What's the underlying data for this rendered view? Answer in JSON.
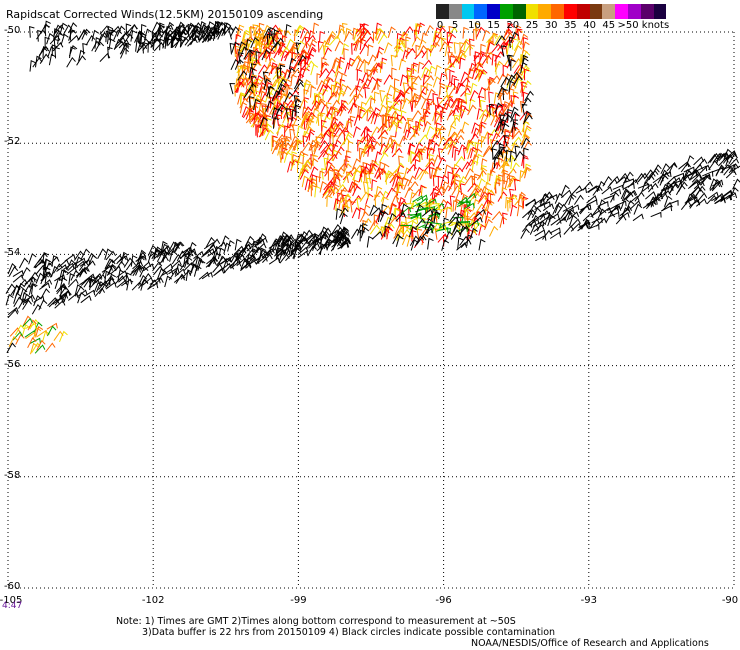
{
  "title": "Rapidscat Corrected Winds(12.5KM) 20150109 ascending",
  "legend": {
    "colors": [
      "#222222",
      "#888888",
      "#00c8f0",
      "#0066ff",
      "#0000c8",
      "#00a000",
      "#006400",
      "#f0e000",
      "#ffaa00",
      "#ff6600",
      "#ff0000",
      "#c00000",
      "#7a3a10",
      "#c8a080",
      "#ff00ff",
      "#a000c8",
      "#5a006a",
      "#1a0040"
    ],
    "labels": [
      {
        "text": "0",
        "frac": 0.0
      },
      {
        "text": "5",
        "frac": 0.083
      },
      {
        "text": "10",
        "frac": 0.167
      },
      {
        "text": "15",
        "frac": 0.25
      },
      {
        "text": "20",
        "frac": 0.333
      },
      {
        "text": "25",
        "frac": 0.417
      },
      {
        "text": "30",
        "frac": 0.5
      },
      {
        "text": "35",
        "frac": 0.583
      },
      {
        "text": "40",
        "frac": 0.667
      },
      {
        "text": "45",
        "frac": 0.75
      },
      {
        "text": ">50 knots",
        "frac": 0.9
      }
    ]
  },
  "axes": {
    "lat_labels": [
      {
        "text": "-50",
        "value": -50
      },
      {
        "text": "-52",
        "value": -52
      },
      {
        "text": "-54",
        "value": -54
      },
      {
        "text": "-56",
        "value": -56
      },
      {
        "text": "-58",
        "value": -58
      },
      {
        "text": "-60",
        "value": -60
      }
    ],
    "lon_labels": [
      {
        "text": "-105",
        "value": -105
      },
      {
        "text": "-102",
        "value": -102
      },
      {
        "text": "-99",
        "value": -99
      },
      {
        "text": "-96",
        "value": -96
      },
      {
        "text": "-93",
        "value": -93
      },
      {
        "text": "-90",
        "value": -90
      }
    ],
    "lat_range": [
      -60,
      -50
    ],
    "lon_range": [
      -105,
      -90
    ]
  },
  "time_label": "4:47",
  "notes": {
    "line1": "Note: 1) Times are GMT 2)Times along bottom correspond to measurement at ~50S",
    "line2": "3)Data buffer is 22 hrs from 20150109 4) Black circles indicate possible contamination"
  },
  "credit": "NOAA/NESDIS/Office of Research and Applications",
  "wind_colors": {
    "rain_flag": "#000000",
    "c15": "#00a000",
    "c20": "#f0e000",
    "c25": "#ffaa00",
    "c30": "#ff6600",
    "c35": "#ff0000"
  }
}
